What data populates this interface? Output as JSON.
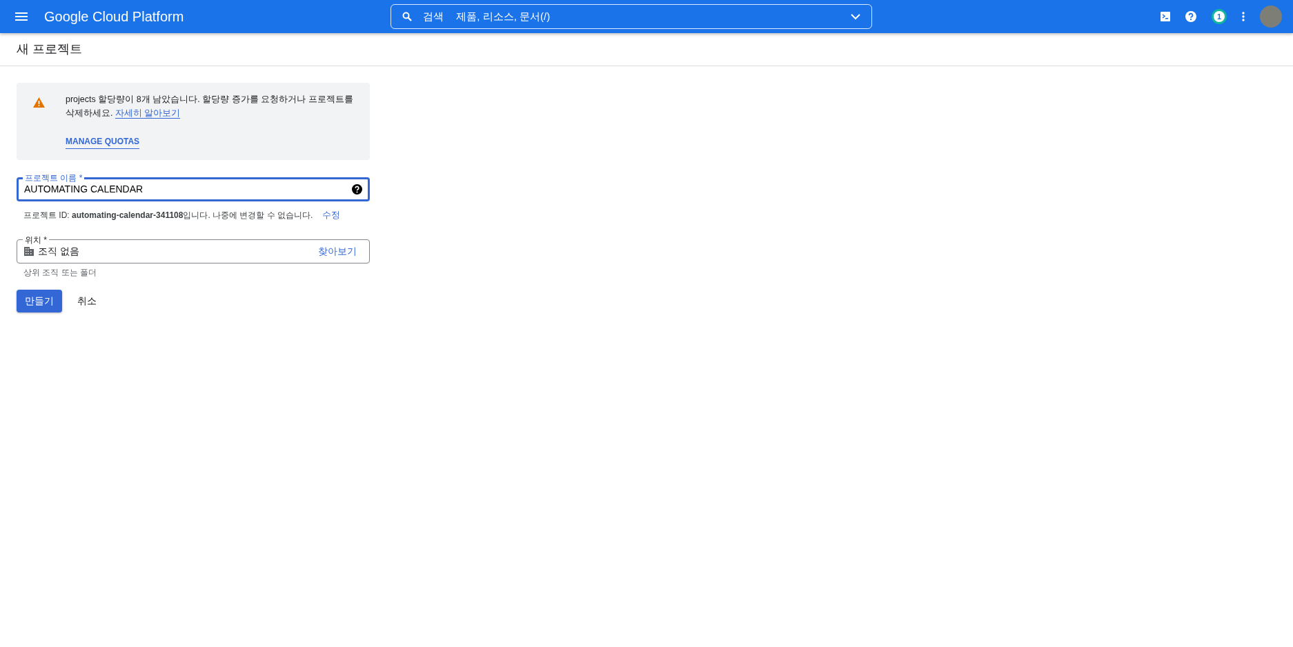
{
  "header": {
    "product": "Google Cloud Platform",
    "search": {
      "label": "검색",
      "placeholder": "제품, 리소스, 문서(/)"
    },
    "notification_count": "1"
  },
  "page_title": "새 프로젝트",
  "alert": {
    "message": "projects 할당량이 8개 남았습니다. 할당량 증가를 요청하거나 프로젝트를 삭제하세요.",
    "link": "자세히 알아보기",
    "action": "MANAGE QUOTAS"
  },
  "project_name": {
    "label": "프로젝트 이름 *",
    "value": "AUTOMATING CALENDAR",
    "focused": true
  },
  "project_id": {
    "text": "프로젝트 ID: **automating-calendar-341108**입니다. 나중에 변경할 수 없습니다.",
    "edit": "수정"
  },
  "location": {
    "label": "위치 *",
    "value": "조직 없음",
    "browse": "찾아보기",
    "hint": "상위 조직 또는 폴더"
  },
  "buttons": {
    "create": "만들기",
    "cancel": "취소"
  }
}
